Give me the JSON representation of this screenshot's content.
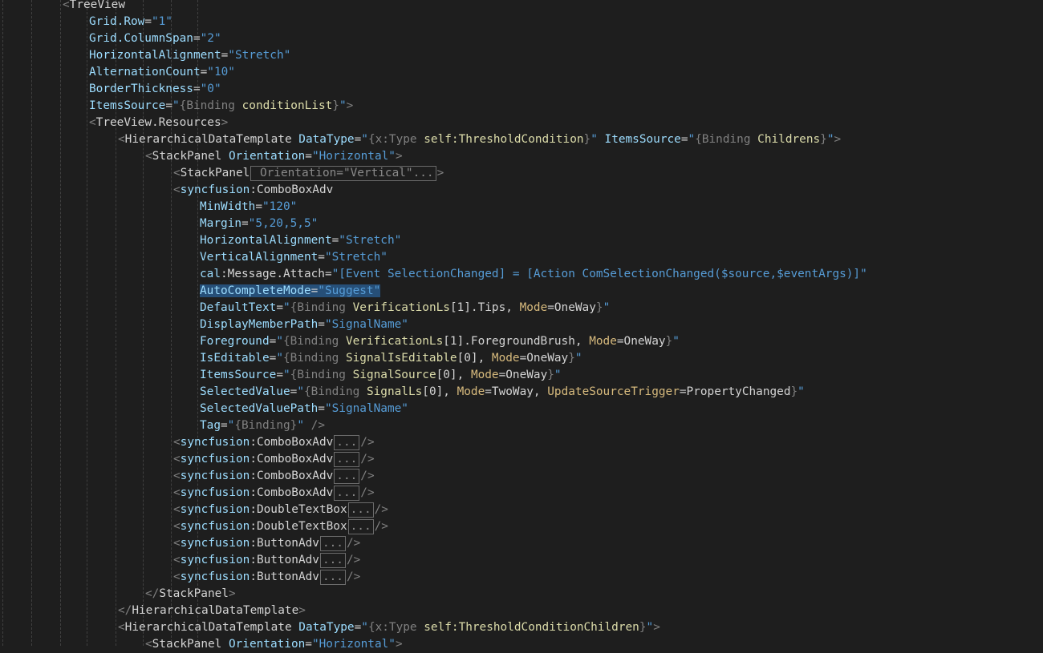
{
  "editor": {
    "lines": [
      {
        "indent": 2,
        "parts": [
          [
            "br",
            "<"
          ],
          [
            "tag",
            "TreeView"
          ]
        ]
      },
      {
        "indent": 3,
        "parts": [
          [
            "attr",
            "Grid.Row"
          ],
          [
            "eq",
            "="
          ],
          [
            "str",
            "\"1\""
          ]
        ]
      },
      {
        "indent": 3,
        "parts": [
          [
            "attr",
            "Grid.ColumnSpan"
          ],
          [
            "eq",
            "="
          ],
          [
            "str",
            "\"2\""
          ]
        ]
      },
      {
        "indent": 3,
        "parts": [
          [
            "attr",
            "HorizontalAlignment"
          ],
          [
            "eq",
            "="
          ],
          [
            "str",
            "\"Stretch\""
          ]
        ]
      },
      {
        "indent": 3,
        "parts": [
          [
            "attr",
            "AlternationCount"
          ],
          [
            "eq",
            "="
          ],
          [
            "str",
            "\"10\""
          ]
        ]
      },
      {
        "indent": 3,
        "parts": [
          [
            "attr",
            "BorderThickness"
          ],
          [
            "eq",
            "="
          ],
          [
            "str",
            "\"0\""
          ]
        ]
      },
      {
        "indent": 3,
        "parts": [
          [
            "attr",
            "ItemsSource"
          ],
          [
            "eq",
            "="
          ],
          [
            "str",
            "\""
          ],
          [
            "ext",
            "{Binding "
          ],
          [
            "bpath",
            "conditionList"
          ],
          [
            "ext",
            "}"
          ],
          [
            "str",
            "\""
          ],
          [
            "br",
            ">"
          ]
        ]
      },
      {
        "indent": 3,
        "parts": [
          [
            "br",
            "<"
          ],
          [
            "tag",
            "TreeView.Resources"
          ],
          [
            "br",
            ">"
          ]
        ]
      },
      {
        "indent": 4,
        "parts": [
          [
            "br",
            "<"
          ],
          [
            "tag",
            "HierarchicalDataTemplate "
          ],
          [
            "attr",
            "DataType"
          ],
          [
            "eq",
            "="
          ],
          [
            "str",
            "\""
          ],
          [
            "ext",
            "{x:Type "
          ],
          [
            "bpath",
            "self:ThresholdCondition"
          ],
          [
            "ext",
            "}"
          ],
          [
            "str",
            "\" "
          ],
          [
            "attr",
            "ItemsSource"
          ],
          [
            "eq",
            "="
          ],
          [
            "str",
            "\""
          ],
          [
            "ext",
            "{Binding "
          ],
          [
            "bpath",
            "Childrens"
          ],
          [
            "ext",
            "}"
          ],
          [
            "str",
            "\""
          ],
          [
            "br",
            ">"
          ]
        ]
      },
      {
        "indent": 5,
        "parts": [
          [
            "br",
            "<"
          ],
          [
            "tag",
            "StackPanel "
          ],
          [
            "attr",
            "Orientation"
          ],
          [
            "eq",
            "="
          ],
          [
            "str",
            "\"Horizontal\""
          ],
          [
            "br",
            ">"
          ]
        ]
      },
      {
        "indent": 6,
        "parts": [
          [
            "br",
            "<"
          ],
          [
            "tag",
            "StackPanel"
          ],
          [
            "collapsed",
            " Orientation=\"Vertical\"..."
          ],
          [
            "br",
            ">"
          ]
        ]
      },
      {
        "indent": 6,
        "parts": [
          [
            "br",
            "<"
          ],
          [
            "ns",
            "syncfusion"
          ],
          [
            "eq",
            ":"
          ],
          [
            "tag",
            "ComboBoxAdv"
          ]
        ]
      },
      {
        "indent": 7,
        "parts": [
          [
            "attr",
            "MinWidth"
          ],
          [
            "eq",
            "="
          ],
          [
            "str",
            "\"120\""
          ]
        ]
      },
      {
        "indent": 7,
        "parts": [
          [
            "attr",
            "Margin"
          ],
          [
            "eq",
            "="
          ],
          [
            "str",
            "\"5,20,5,5\""
          ]
        ]
      },
      {
        "indent": 7,
        "parts": [
          [
            "attr",
            "HorizontalAlignment"
          ],
          [
            "eq",
            "="
          ],
          [
            "str",
            "\"Stretch\""
          ]
        ]
      },
      {
        "indent": 7,
        "parts": [
          [
            "attr",
            "VerticalAlignment"
          ],
          [
            "eq",
            "="
          ],
          [
            "str",
            "\"Stretch\""
          ]
        ]
      },
      {
        "indent": 7,
        "parts": [
          [
            "attr",
            "cal"
          ],
          [
            "eq",
            ":"
          ],
          [
            "tag",
            "Message.Attach"
          ],
          [
            "eq",
            "="
          ],
          [
            "str",
            "\"[Event SelectionChanged] = [Action ComSelectionChanged($source,$eventArgs)]\""
          ]
        ]
      },
      {
        "indent": 7,
        "sel": true,
        "parts": [
          [
            "attr",
            "AutoCompleteMode"
          ],
          [
            "eq",
            "="
          ],
          [
            "str",
            "\"Suggest\""
          ]
        ]
      },
      {
        "indent": 7,
        "parts": [
          [
            "attr",
            "DefaultText"
          ],
          [
            "eq",
            "="
          ],
          [
            "str",
            "\""
          ],
          [
            "ext",
            "{Binding "
          ],
          [
            "bpath",
            "VerificationLs"
          ],
          [
            "eq",
            "[1].Tips, "
          ],
          [
            "bkw",
            "Mode"
          ],
          [
            "eq",
            "=OneWay"
          ],
          [
            "ext",
            "}"
          ],
          [
            "str",
            "\""
          ]
        ]
      },
      {
        "indent": 7,
        "parts": [
          [
            "attr",
            "DisplayMemberPath"
          ],
          [
            "eq",
            "="
          ],
          [
            "str",
            "\"SignalName\""
          ]
        ]
      },
      {
        "indent": 7,
        "parts": [
          [
            "attr",
            "Foreground"
          ],
          [
            "eq",
            "="
          ],
          [
            "str",
            "\""
          ],
          [
            "ext",
            "{Binding "
          ],
          [
            "bpath",
            "VerificationLs"
          ],
          [
            "eq",
            "[1].ForegroundBrush, "
          ],
          [
            "bkw",
            "Mode"
          ],
          [
            "eq",
            "=OneWay"
          ],
          [
            "ext",
            "}"
          ],
          [
            "str",
            "\""
          ]
        ]
      },
      {
        "indent": 7,
        "parts": [
          [
            "attr",
            "IsEditable"
          ],
          [
            "eq",
            "="
          ],
          [
            "str",
            "\""
          ],
          [
            "ext",
            "{Binding "
          ],
          [
            "bpath",
            "SignalIsEditable"
          ],
          [
            "eq",
            "[0], "
          ],
          [
            "bkw",
            "Mode"
          ],
          [
            "eq",
            "=OneWay"
          ],
          [
            "ext",
            "}"
          ],
          [
            "str",
            "\""
          ]
        ]
      },
      {
        "indent": 7,
        "parts": [
          [
            "attr",
            "ItemsSource"
          ],
          [
            "eq",
            "="
          ],
          [
            "str",
            "\""
          ],
          [
            "ext",
            "{Binding "
          ],
          [
            "bpath",
            "SignalSource"
          ],
          [
            "eq",
            "[0], "
          ],
          [
            "bkw",
            "Mode"
          ],
          [
            "eq",
            "=OneWay"
          ],
          [
            "ext",
            "}"
          ],
          [
            "str",
            "\""
          ]
        ]
      },
      {
        "indent": 7,
        "parts": [
          [
            "attr",
            "SelectedValue"
          ],
          [
            "eq",
            "="
          ],
          [
            "str",
            "\""
          ],
          [
            "ext",
            "{Binding "
          ],
          [
            "bpath",
            "SignalLs"
          ],
          [
            "eq",
            "[0], "
          ],
          [
            "bkw",
            "Mode"
          ],
          [
            "eq",
            "=TwoWay, "
          ],
          [
            "bkw",
            "UpdateSourceTrigger"
          ],
          [
            "eq",
            "=PropertyChanged"
          ],
          [
            "ext",
            "}"
          ],
          [
            "str",
            "\""
          ]
        ]
      },
      {
        "indent": 7,
        "parts": [
          [
            "attr",
            "SelectedValuePath"
          ],
          [
            "eq",
            "="
          ],
          [
            "str",
            "\"SignalName\""
          ]
        ]
      },
      {
        "indent": 7,
        "parts": [
          [
            "attr",
            "Tag"
          ],
          [
            "eq",
            "="
          ],
          [
            "str",
            "\""
          ],
          [
            "ext",
            "{Binding}"
          ],
          [
            "str",
            "\""
          ],
          [
            "br",
            " />"
          ]
        ]
      },
      {
        "indent": 6,
        "parts": [
          [
            "br",
            "<"
          ],
          [
            "ns",
            "syncfusion"
          ],
          [
            "eq",
            ":"
          ],
          [
            "tag",
            "ComboBoxAdv"
          ],
          [
            "collapsed",
            "..."
          ],
          [
            "br",
            "/>"
          ]
        ]
      },
      {
        "indent": 6,
        "parts": [
          [
            "br",
            "<"
          ],
          [
            "ns",
            "syncfusion"
          ],
          [
            "eq",
            ":"
          ],
          [
            "tag",
            "ComboBoxAdv"
          ],
          [
            "collapsed",
            "..."
          ],
          [
            "br",
            "/>"
          ]
        ]
      },
      {
        "indent": 6,
        "parts": [
          [
            "br",
            "<"
          ],
          [
            "ns",
            "syncfusion"
          ],
          [
            "eq",
            ":"
          ],
          [
            "tag",
            "ComboBoxAdv"
          ],
          [
            "collapsed",
            "..."
          ],
          [
            "br",
            "/>"
          ]
        ]
      },
      {
        "indent": 6,
        "parts": [
          [
            "br",
            "<"
          ],
          [
            "ns",
            "syncfusion"
          ],
          [
            "eq",
            ":"
          ],
          [
            "tag",
            "ComboBoxAdv"
          ],
          [
            "collapsed",
            "..."
          ],
          [
            "br",
            "/>"
          ]
        ]
      },
      {
        "indent": 6,
        "parts": [
          [
            "br",
            "<"
          ],
          [
            "ns",
            "syncfusion"
          ],
          [
            "eq",
            ":"
          ],
          [
            "tag",
            "DoubleTextBox"
          ],
          [
            "collapsed",
            "..."
          ],
          [
            "br",
            "/>"
          ]
        ]
      },
      {
        "indent": 6,
        "parts": [
          [
            "br",
            "<"
          ],
          [
            "ns",
            "syncfusion"
          ],
          [
            "eq",
            ":"
          ],
          [
            "tag",
            "DoubleTextBox"
          ],
          [
            "collapsed",
            "..."
          ],
          [
            "br",
            "/>"
          ]
        ]
      },
      {
        "indent": 6,
        "parts": [
          [
            "br",
            "<"
          ],
          [
            "ns",
            "syncfusion"
          ],
          [
            "eq",
            ":"
          ],
          [
            "tag",
            "ButtonAdv"
          ],
          [
            "collapsed",
            "..."
          ],
          [
            "br",
            "/>"
          ]
        ]
      },
      {
        "indent": 6,
        "parts": [
          [
            "br",
            "<"
          ],
          [
            "ns",
            "syncfusion"
          ],
          [
            "eq",
            ":"
          ],
          [
            "tag",
            "ButtonAdv"
          ],
          [
            "collapsed",
            "..."
          ],
          [
            "br",
            "/>"
          ]
        ]
      },
      {
        "indent": 6,
        "parts": [
          [
            "br",
            "<"
          ],
          [
            "ns",
            "syncfusion"
          ],
          [
            "eq",
            ":"
          ],
          [
            "tag",
            "ButtonAdv"
          ],
          [
            "collapsed",
            "..."
          ],
          [
            "br",
            "/>"
          ]
        ]
      },
      {
        "indent": 5,
        "parts": [
          [
            "br",
            "</"
          ],
          [
            "tag",
            "StackPanel"
          ],
          [
            "br",
            ">"
          ]
        ]
      },
      {
        "indent": 4,
        "parts": [
          [
            "br",
            "</"
          ],
          [
            "tag",
            "HierarchicalDataTemplate"
          ],
          [
            "br",
            ">"
          ]
        ]
      },
      {
        "indent": 4,
        "parts": [
          [
            "br",
            "<"
          ],
          [
            "tag",
            "HierarchicalDataTemplate "
          ],
          [
            "attr",
            "DataType"
          ],
          [
            "eq",
            "="
          ],
          [
            "str",
            "\""
          ],
          [
            "ext",
            "{x:Type "
          ],
          [
            "bpath",
            "self:ThresholdConditionChildren"
          ],
          [
            "ext",
            "}"
          ],
          [
            "str",
            "\""
          ],
          [
            "br",
            ">"
          ]
        ]
      },
      {
        "indent": 5,
        "parts": [
          [
            "br",
            "<"
          ],
          [
            "tag",
            "StackPanel "
          ],
          [
            "attr",
            "Orientation"
          ],
          [
            "eq",
            "="
          ],
          [
            "str",
            "\"Horizontal\""
          ],
          [
            "br",
            ">"
          ]
        ]
      }
    ]
  },
  "colors": {
    "background": "#1e1e1e",
    "attribute": "#9cdcfe",
    "string": "#569cd6",
    "binding_path": "#dcdcaa",
    "selection": "#264f78"
  }
}
